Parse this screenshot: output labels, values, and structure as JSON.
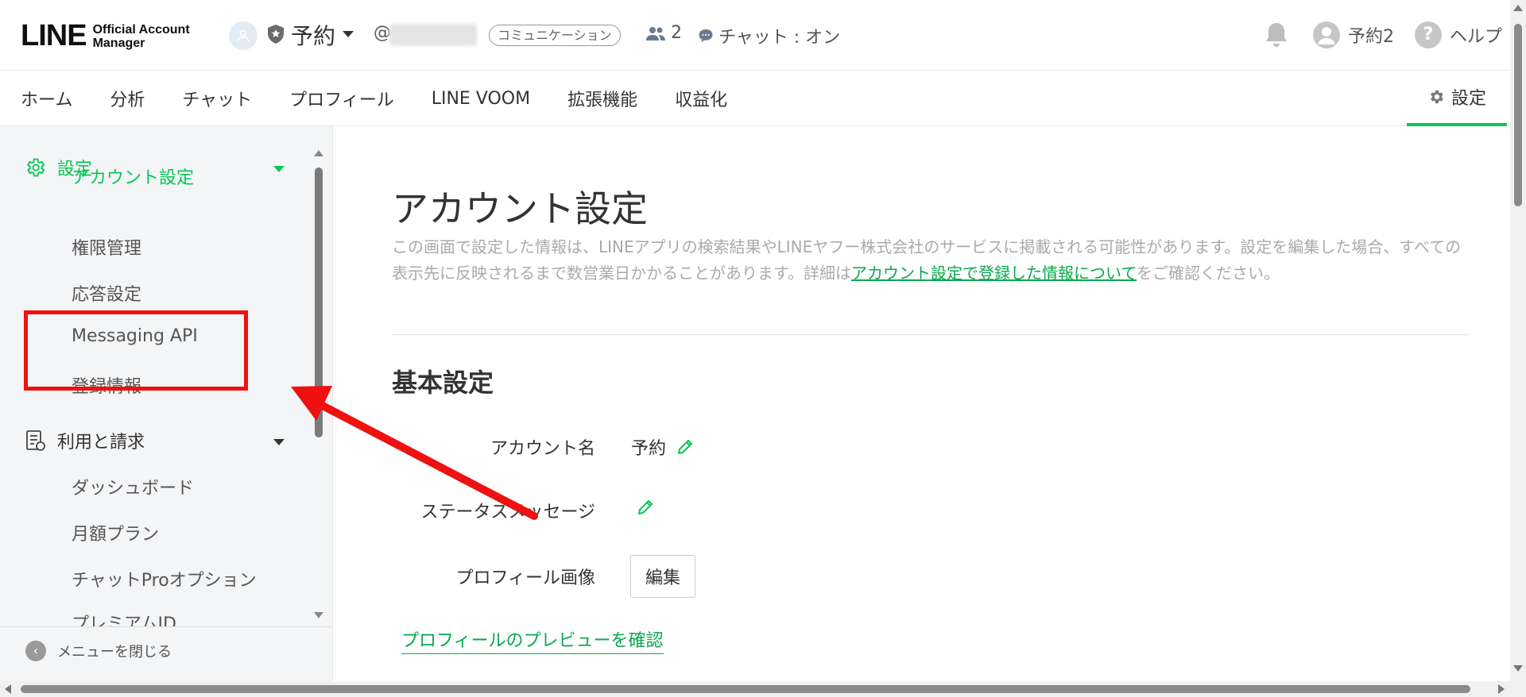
{
  "header": {
    "logo_main": "LINE",
    "logo_sub_1": "Official Account",
    "logo_sub_2": "Manager",
    "account_name": "予約",
    "account_id_prefix": "@",
    "account_type_badge": "コミュニケーション",
    "friends_count": "2",
    "chat_status": "チャット : オン",
    "user_name": "予約2",
    "help_label": "ヘルプ"
  },
  "nav": {
    "tabs": [
      "ホーム",
      "分析",
      "チャット",
      "プロフィール",
      "LINE VOOM",
      "拡張機能",
      "収益化"
    ],
    "settings_label": "設定"
  },
  "sidebar": {
    "settings_section": "設定",
    "settings_items": [
      "アカウント設定",
      "権限管理",
      "応答設定",
      "Messaging API",
      "登録情報"
    ],
    "billing_section": "利用と請求",
    "billing_items": [
      "ダッシュボード",
      "月額プラン",
      "チャットProオプション",
      "プレミアムID"
    ],
    "close_menu": "メニューを閉じる"
  },
  "main": {
    "title": "アカウント設定",
    "description_1": "この画面で設定した情報は、LINEアプリの検索結果やLINEヤフー株式会社のサービスに掲載される可能性があります。設定を編集した場合、すべての表示先に反映されるまで数営業日かかることがあります。詳細は",
    "description_link": "アカウント設定で登録した情報について",
    "description_2": "をご確認ください。",
    "section_basic": "基本設定",
    "account_name_label": "アカウント名",
    "account_name_value": "予約",
    "status_message_label": "ステータスメッセージ",
    "profile_image_label": "プロフィール画像",
    "edit_button": "編集",
    "preview_link": "プロフィールのプレビューを確認"
  },
  "colors": {
    "accent_green": "#06c755",
    "link_green": "#06a94d",
    "annotation_red": "#ee1111"
  }
}
